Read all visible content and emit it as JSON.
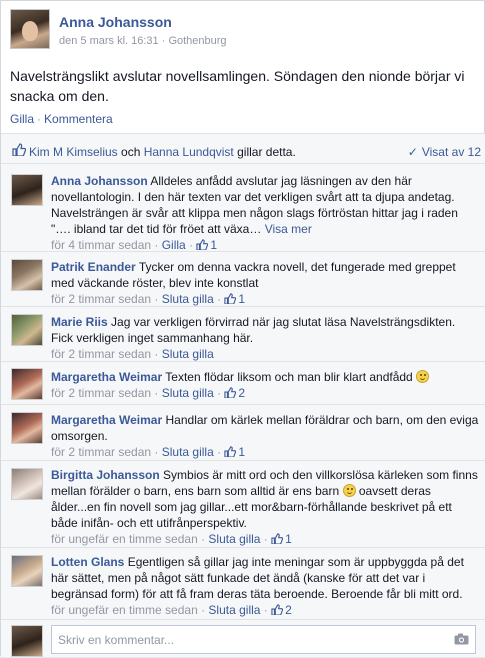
{
  "post": {
    "author": "Anna Johansson",
    "date": "den 5 mars kl. 16:31",
    "sep": " · ",
    "location": "Gothenburg",
    "text": "Navelsträngslikt avslutar novellsamlingen. Söndagen den nionde börjar vi snacka om den.",
    "actions": {
      "like": "Gilla",
      "comment": "Kommentera"
    }
  },
  "likes": {
    "name1": "Kim M Kimselius",
    "and": " och ",
    "name2": "Hanna Lundqvist",
    "suffix": " gillar detta.",
    "seen": "Visat av 12"
  },
  "comments": [
    {
      "name": "Anna Johansson",
      "text": "Alldeles anfådd avslutar jag läsningen av den här novellantologin. I den här texten var det verkligen svårt att ta djupa andetag. Navelsträngen är svår att klippa men någon slags förtröstan hittar jag i raden \"…. ibland tar det tid för fröet att växa…",
      "more": "Visa mer",
      "time": "för 4 timmar sedan",
      "action": "Gilla",
      "count": "1"
    },
    {
      "name": "Patrik Enander",
      "text": "Tycker om denna vackra novell, det fungerade med greppet med väckande röster, blev inte konstlat",
      "time": "för 2 timmar sedan",
      "action": "Sluta gilla",
      "count": "1"
    },
    {
      "name": "Marie Riis",
      "text": "Jag var verkligen förvirrad när jag slutat läsa Navelsträngsdikten. Fick verkligen inget sammanhang här.",
      "time": "för 2 timmar sedan",
      "action": "Sluta gilla"
    },
    {
      "name": "Margaretha Weimar",
      "text": "Texten flödar liksom och man blir klart andfådd",
      "time": "för 2 timmar sedan",
      "action": "Sluta gilla",
      "count": "2"
    },
    {
      "name": "Margaretha Weimar",
      "text": "Handlar om kärlek mellan föräldrar och barn, om den eviga omsorgen.",
      "time": "för 2 timmar sedan",
      "action": "Sluta gilla",
      "count": "1"
    },
    {
      "name": "Birgitta Johansson",
      "text_a": "Symbios är mitt ord och den villkorslösa kärleken som finns mellan förälder o barn, ens barn som alltid är ens barn",
      "text_b": "oavsett deras ålder...en fin novell som jag gillar...ett mor&barn-förhållande beskrivet på ett både inifån- och ett utifrånperspektiv.",
      "time": "för ungefär en timme sedan",
      "action": "Sluta gilla",
      "count": "1"
    },
    {
      "name": "Lotten Glans",
      "text": "Egentligen så gillar jag inte meningar som är uppbyggda på det här sättet, men på något sätt funkade det ändå (kanske för att det var i begränsad form) för att få fram deras täta beroende. Beroende får bli mitt ord.",
      "time": "för ungefär en timme sedan",
      "action": "Sluta gilla",
      "count": "2"
    }
  ],
  "composer": {
    "placeholder": "Skriv en kommentar..."
  },
  "sep": " · ",
  "colors": {
    "link": "#3b5998",
    "muted": "#9197a3",
    "ufi_bg": "#f6f7f8"
  },
  "icons": [
    "thumbs-up-icon",
    "checkmark-icon",
    "smiley-emoji-icon",
    "camera-icon"
  ]
}
